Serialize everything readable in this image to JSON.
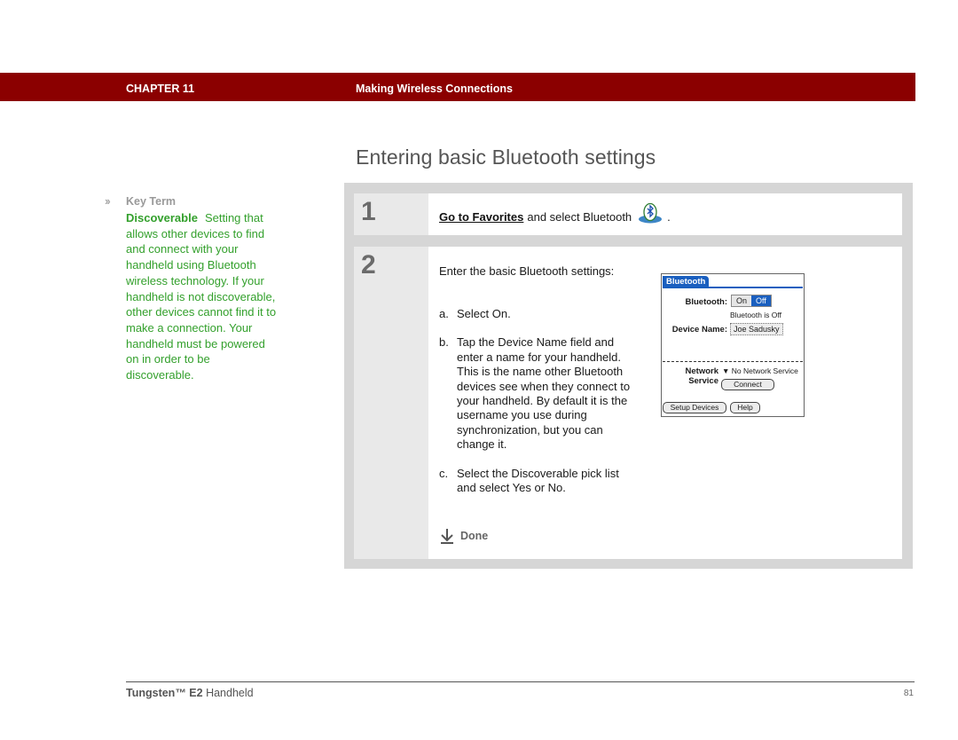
{
  "header": {
    "chapter": "CHAPTER 11",
    "section": "Making Wireless Connections",
    "bar_color": "#8b0000"
  },
  "title": "Entering basic Bluetooth settings",
  "key_term": {
    "icon": "double-chevron-right-icon",
    "heading": "Key Term",
    "term": "Discoverable",
    "definition": "Setting that allows other devices to find and connect with your handheld using Bluetooth wireless technology. If your handheld is not discoverable, other devices cannot find it to make a connection. Your handheld must be powered on in order to be discoverable.",
    "color": "#33a02c"
  },
  "steps": [
    {
      "number": "1",
      "link": "Go to Favorites",
      "text": "and select Bluetooth",
      "icon": "bluetooth-app-icon",
      "suffix": "."
    },
    {
      "number": "2",
      "intro": "Enter the basic Bluetooth settings:",
      "substeps": [
        {
          "label": "a.",
          "text": "Select On."
        },
        {
          "label": "b.",
          "text": "Tap the Device Name field and enter a name for your handheld. This is the name other Bluetooth devices see when they connect to your handheld. By default it is the username you use during synchronization, but you can change it."
        },
        {
          "label": "c.",
          "text": "Select the Discoverable pick list and select Yes or No."
        }
      ],
      "done_label": "Done"
    }
  ],
  "palm_screen": {
    "tab": "Bluetooth",
    "bluetooth_label": "Bluetooth:",
    "on": "On",
    "off": "Off",
    "selected": "Off",
    "status": "Bluetooth is Off",
    "device_name_label": "Device Name:",
    "device_name": "Joe Sadusky",
    "network_label_1": "Network",
    "network_label_2": "Service",
    "network_value": "No Network Service",
    "connect": "Connect",
    "setup_devices": "Setup Devices",
    "help": "Help"
  },
  "footer": {
    "brand": "Tungsten™ E2",
    "product": "Handheld",
    "page": "81"
  }
}
